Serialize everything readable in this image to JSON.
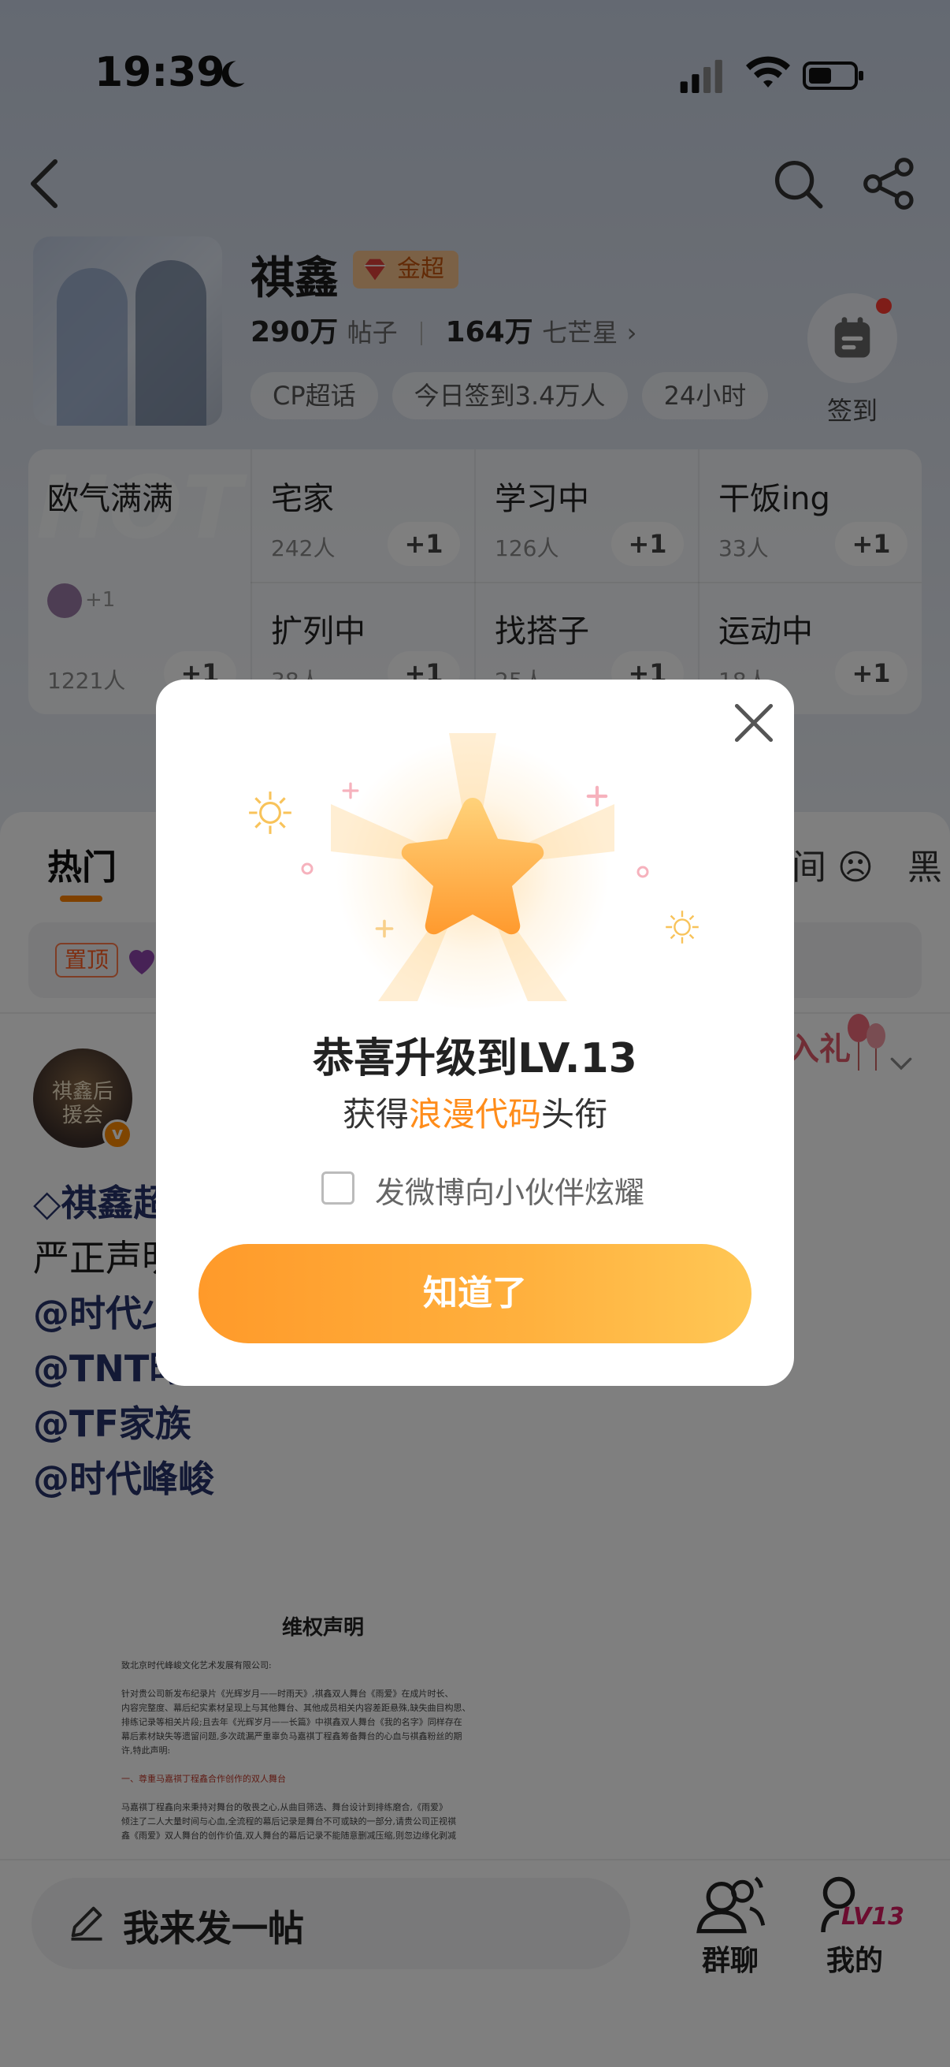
{
  "status_bar": {
    "time": "19:39"
  },
  "topic": {
    "name": "祺鑫",
    "badge": "金超",
    "posts_count": "290万",
    "posts_unit": "帖子",
    "fans_count": "164万",
    "fans_unit": "七芒星",
    "tags": [
      "CP超话",
      "今日签到3.4万人",
      "24小时"
    ],
    "checkin_label": "签到"
  },
  "status_grid": {
    "watermark": "HOT",
    "featured": {
      "title": "欧气满满",
      "mini_plus": "+1",
      "count": "1221人"
    },
    "cells": [
      {
        "title": "宅家",
        "count": "242人"
      },
      {
        "title": "学习中",
        "count": "126人"
      },
      {
        "title": "干饭ing",
        "count": "33人"
      },
      {
        "title": "扩列中",
        "count": "38人"
      },
      {
        "title": "找搭子",
        "count": "25人"
      },
      {
        "title": "运动中",
        "count": "18人"
      }
    ],
    "plus_label": "+1"
  },
  "tabs": {
    "hot": "热门",
    "right1": "间",
    "right2": "黑"
  },
  "pinned": {
    "badge": "置顶"
  },
  "post": {
    "avatar_text": "祺鑫后援会",
    "v_badge": "v",
    "gift_text": "入礼",
    "lines": [
      "祺鑫超",
      "严正声明",
      "@时代少",
      "@TNT时",
      "@TF家族",
      "@时代峰峻"
    ],
    "doc": {
      "title": "维权声明",
      "lines": [
        "致北京时代峰峻文化艺术发展有限公司:",
        "针对贵公司新发布纪录片《光辉岁月——时雨天》,祺鑫双人舞台《雨爱》在成片时长、",
        "内容完整度、幕后纪实素材呈现上与其他舞台、其他成员相关内容差距悬殊,缺失曲目构思、",
        "排练记录等相关片段;且去年《光辉岁月——长篇》中祺鑫双人舞台《我的名字》同样存在",
        "幕后素材缺失等遗留问题,多次疏漏严重辜负马嘉祺丁程鑫筹备舞台的心血与祺鑫粉丝的期",
        "许,特此声明:",
        "一、尊重马嘉祺丁程鑫合作创作的双人舞台",
        "马嘉祺丁程鑫向来秉持对舞台的敬畏之心,从曲目筛选、舞台设计到排练磨合,《雨爱》",
        "倾注了二人大量时间与心血,全流程的幕后记录是舞台不可或缺的一部分,请贵公司正视祺",
        "鑫《雨爱》双人舞台的创作价值,双人舞台的幕后记录不能随意删减压缩,则忽边缘化剥减"
      ]
    }
  },
  "bottom_bar": {
    "compose_text": "我来发一帖",
    "group_chat": "群聊",
    "mine": "我的",
    "level_tag": "LV13"
  },
  "modal": {
    "title": "恭喜升级到LV.13",
    "subtitle_prefix": "获得",
    "subtitle_highlight": "浪漫代码",
    "subtitle_suffix": "头衔",
    "share_label": "发微博向小伙伴炫耀",
    "share_checked": false,
    "button_label": "知道了"
  },
  "colors": {
    "accent": "#ff8c1a",
    "button_gradient_start": "#ff9a2a",
    "button_gradient_end": "#ffc755",
    "link": "#26336b",
    "overlay": "rgba(0,0,0,0.5)"
  }
}
